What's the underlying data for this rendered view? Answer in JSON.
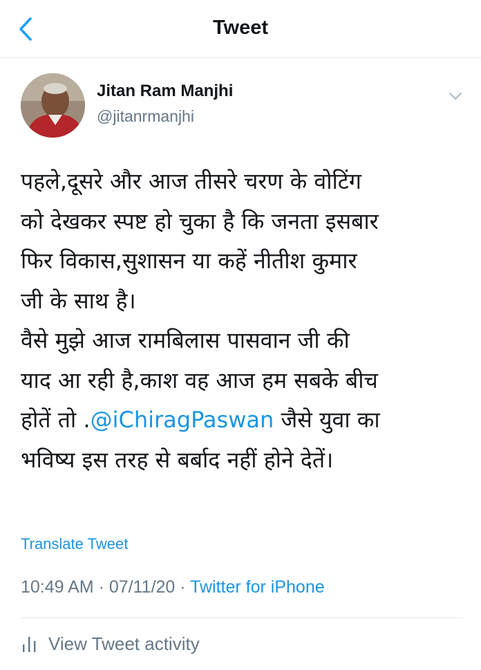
{
  "header": {
    "title": "Tweet",
    "back_icon": "chevron-left-icon"
  },
  "author": {
    "name": "Jitan Ram Manjhi",
    "handle": "@jitanrmanjhi"
  },
  "tweet": {
    "lines": [
      "पहले,दूसरे और आज तीसरे चरण के वोटिंग",
      "को देखकर स्पष्ट हो चुका है कि जनता इसबार",
      "फिर विकास,सुशासन या कहें नीतीश कुमार",
      "जी के साथ है।",
      "वैसे मुझे आज रामबिलास पासवान जी की",
      "याद आ रही है,काश वह आज हम सबके बीच"
    ],
    "line7_before": "होतें तो .",
    "mention": "@iChiragPaswan",
    "line7_after": " जैसे युवा का",
    "line8": "भविष्य इस तरह से बर्बाद नहीं होने देतें।"
  },
  "translate_label": "Translate Tweet",
  "meta": {
    "time": "10:49 AM",
    "date": "07/11/20",
    "source": "Twitter for iPhone"
  },
  "activity_label": "View Tweet activity",
  "colors": {
    "accent": "#1b95e0",
    "secondary_text": "#657786",
    "divider": "#e1e8ed"
  }
}
